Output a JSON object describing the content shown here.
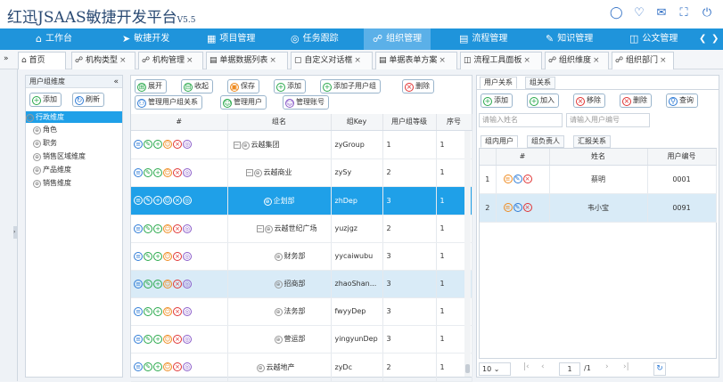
{
  "header": {
    "title": "红迅JSAAS敏捷开发平台",
    "version": "V5.5"
  },
  "nav": [
    {
      "label": "工作台",
      "icon": "home-icon"
    },
    {
      "label": "敏捷开发",
      "icon": "plane-icon"
    },
    {
      "label": "项目管理",
      "icon": "grid-icon"
    },
    {
      "label": "任务跟踪",
      "icon": "target-icon"
    },
    {
      "label": "组织管理",
      "icon": "org-icon"
    },
    {
      "label": "流程管理",
      "icon": "list-icon"
    },
    {
      "label": "知识管理",
      "icon": "edit-icon"
    },
    {
      "label": "公文管理",
      "icon": "book-icon"
    }
  ],
  "tabs": [
    "首页",
    "机构类型",
    "机构管理",
    "单据数据列表",
    "自定义对话框",
    "单据表单方案",
    "流程工具面板",
    "组织维度",
    "组织部门"
  ],
  "left_panel": {
    "title": "用户组维度",
    "add": "添加",
    "refresh": "刷新",
    "items": [
      "行政维度",
      "角色",
      "职务",
      "销售区域维度",
      "产品维度",
      "销售维度"
    ]
  },
  "toolbar": {
    "expand": "展开",
    "collapse": "收起",
    "save": "保存",
    "add": "添加",
    "add_child": "添加子用户组",
    "delete": "删除",
    "manage_rel": "管理用户组关系",
    "manage_user": "管理用户",
    "manage_account": "管理账号"
  },
  "grid": {
    "headers": [
      "#",
      "组名",
      "组Key",
      "用户组等级",
      "序号"
    ],
    "rows": [
      {
        "name": "云越集团",
        "key": "zyGroup",
        "level": "1",
        "seq": "1"
      },
      {
        "name": "云越商业",
        "key": "zySy",
        "level": "2",
        "seq": "1"
      },
      {
        "name": "企划部",
        "key": "zhDep",
        "level": "3",
        "seq": "1"
      },
      {
        "name": "云越世纪广场",
        "key": "yuzjgz",
        "level": "2",
        "seq": "1"
      },
      {
        "name": "财务部",
        "key": "yycaiwubu",
        "level": "3",
        "seq": "1"
      },
      {
        "name": "招商部",
        "key": "zhaoShan...",
        "level": "3",
        "seq": "1"
      },
      {
        "name": "法务部",
        "key": "fwyyDep",
        "level": "3",
        "seq": "1"
      },
      {
        "name": "营运部",
        "key": "yingyunDep",
        "level": "3",
        "seq": "1"
      },
      {
        "name": "云越地产",
        "key": "zyDc",
        "level": "2",
        "seq": "1"
      }
    ]
  },
  "right_panel": {
    "tabs": [
      "用户关系",
      "组关系"
    ],
    "add": "添加",
    "join": "加入",
    "remove": "移除",
    "delete": "删除",
    "query": "查询",
    "name_placeholder": "请输入姓名",
    "code_placeholder": "请输入用户编号",
    "subtabs": [
      "组内用户",
      "组负责人",
      "汇报关系"
    ],
    "headers": [
      "#",
      "姓名",
      "用户编号"
    ],
    "rows": [
      {
        "num": "1",
        "name": "蔡明",
        "code": "0001"
      },
      {
        "num": "2",
        "name": "韦小宝",
        "code": "0091"
      }
    ],
    "pager": {
      "size": "10",
      "page": "1",
      "total": "/1"
    }
  }
}
